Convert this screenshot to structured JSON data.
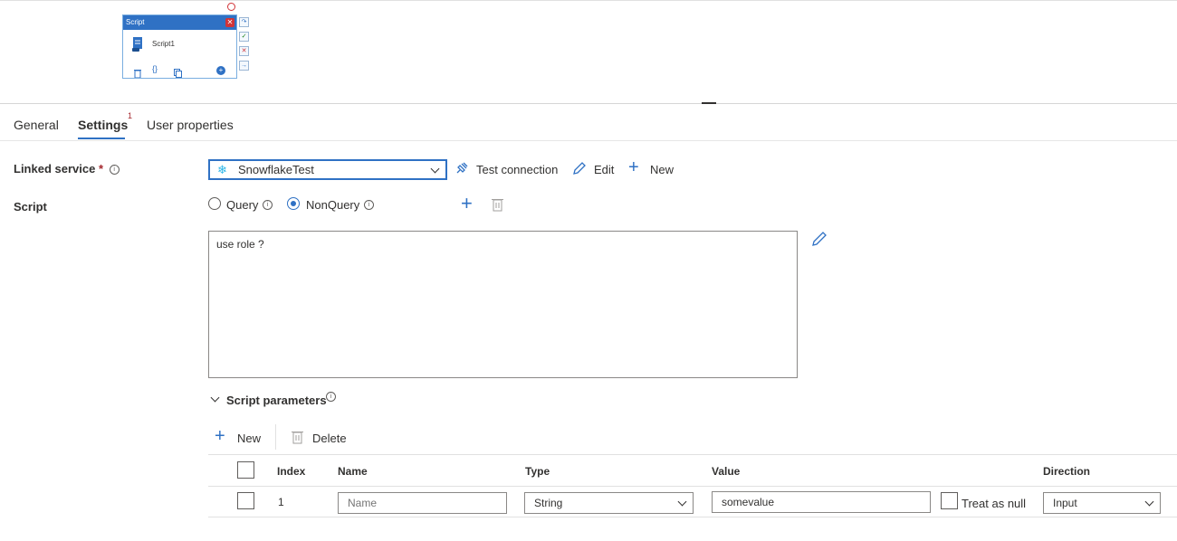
{
  "node": {
    "type_label": "Script",
    "close_glyph": "✕",
    "name": "Script1",
    "icons": [
      "delete-icon",
      "code-icon",
      "copy-icon",
      "add-output-icon"
    ],
    "side_icons": [
      "redo-icon",
      "success-icon",
      "fail-icon",
      "completion-icon"
    ]
  },
  "tabs": [
    {
      "label": "General"
    },
    {
      "label": "Settings",
      "badge": "1",
      "active": true
    },
    {
      "label": "User properties"
    }
  ],
  "linked_service": {
    "label": "Linked service",
    "required": "*",
    "value": "SnowflakeTest",
    "test_connection": "Test connection",
    "edit": "Edit",
    "new": "New"
  },
  "script": {
    "label": "Script",
    "options": [
      {
        "label": "Query",
        "selected": false
      },
      {
        "label": "NonQuery",
        "selected": true
      }
    ],
    "text": "use role ?"
  },
  "script_parameters": {
    "title": "Script parameters",
    "new": "New",
    "delete": "Delete",
    "columns": {
      "index": "Index",
      "name": "Name",
      "type": "Type",
      "value": "Value",
      "direction": "Direction"
    },
    "rows": [
      {
        "index": "1",
        "name_placeholder": "Name",
        "type": "String",
        "value": "somevalue",
        "treat_as_null": "Treat as null",
        "direction": "Input"
      }
    ]
  },
  "colors": {
    "accent": "#2f71c4",
    "required": "#a4262c"
  }
}
